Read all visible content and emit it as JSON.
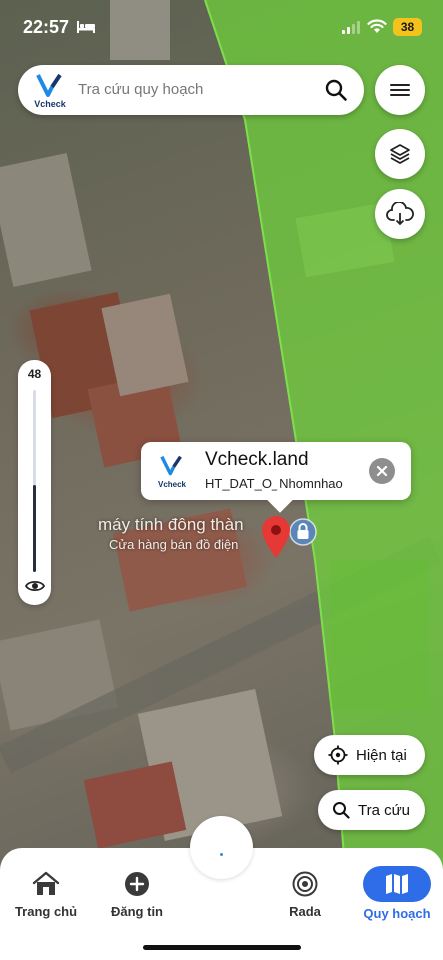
{
  "status_bar": {
    "time": "22:57",
    "battery": "38"
  },
  "search": {
    "logo_text": "Vcheck",
    "placeholder": "Tra cứu quy hoạch"
  },
  "slider": {
    "value": "48",
    "fill_fraction": 0.48
  },
  "map": {
    "shop_name": "máy tính đông thàn",
    "shop_category": "Cửa hàng bán đồ điện",
    "zone_color": "#6fd43a"
  },
  "popup": {
    "logo_text": "Vcheck",
    "title": "Vcheck.land",
    "subtitle": "HT_DAT_O_Nhomnhao"
  },
  "actions": {
    "current_label": "Hiện tại",
    "search_label": "Tra cứu"
  },
  "nav": {
    "items": [
      {
        "label": "Trang chủ",
        "icon": "home-icon"
      },
      {
        "label": "Đăng tin",
        "icon": "plus-circle-icon"
      },
      {
        "label": "Rada",
        "icon": "radar-icon"
      },
      {
        "label": "Quy hoạch",
        "icon": "map-icon",
        "active": true
      }
    ],
    "active_color": "#2e6de7"
  }
}
